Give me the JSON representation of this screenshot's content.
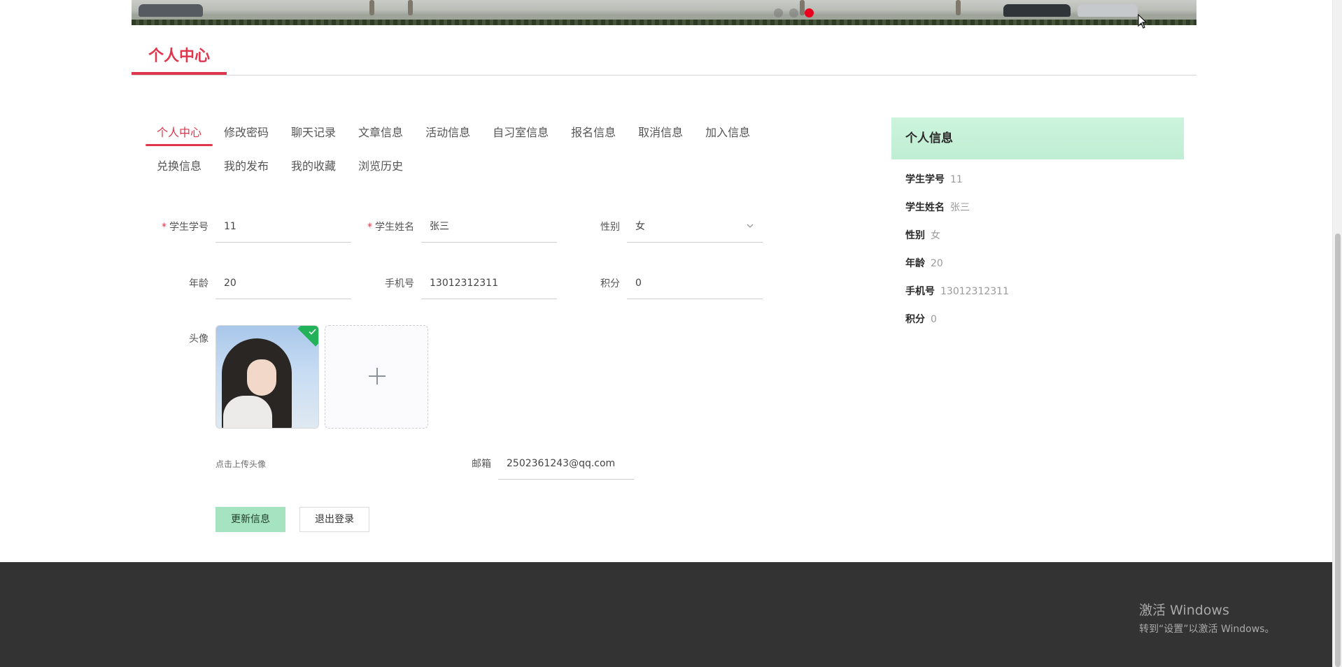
{
  "banner": {
    "carousel_active_index": 2,
    "carousel_count": 3
  },
  "page_title": "个人中心",
  "tabs": [
    {
      "label": "个人中心",
      "active": true
    },
    {
      "label": "修改密码"
    },
    {
      "label": "聊天记录"
    },
    {
      "label": "文章信息"
    },
    {
      "label": "活动信息"
    },
    {
      "label": "自习室信息"
    },
    {
      "label": "报名信息"
    },
    {
      "label": "取消信息"
    },
    {
      "label": "加入信息"
    },
    {
      "label": "兑换信息"
    },
    {
      "label": "我的发布"
    },
    {
      "label": "我的收藏"
    },
    {
      "label": "浏览历史"
    }
  ],
  "form": {
    "student_id": {
      "label": "学生学号",
      "value": "11",
      "required": true
    },
    "student_name": {
      "label": "学生姓名",
      "value": "张三",
      "required": true
    },
    "gender": {
      "label": "性别",
      "value": "女"
    },
    "age": {
      "label": "年龄",
      "value": "20"
    },
    "phone": {
      "label": "手机号",
      "value": "13012312311"
    },
    "points": {
      "label": "积分",
      "value": "0"
    },
    "avatar": {
      "label": "头像",
      "hint": "点击上传头像"
    },
    "email": {
      "label": "邮箱",
      "value": "2502361243@qq.com"
    },
    "update_button": "更新信息",
    "logout_button": "退出登录"
  },
  "info_panel": {
    "title": "个人信息",
    "rows": [
      {
        "key": "学生学号",
        "value": "11"
      },
      {
        "key": "学生姓名",
        "value": "张三"
      },
      {
        "key": "性别",
        "value": "女"
      },
      {
        "key": "年龄",
        "value": "20"
      },
      {
        "key": "手机号",
        "value": "13012312311"
      },
      {
        "key": "积分",
        "value": "0"
      }
    ]
  },
  "watermark": {
    "line1": "激活 Windows",
    "line2": "转到“设置”以激活 Windows。"
  },
  "colors": {
    "accent": "#e0364d",
    "panel_green": "#cdf4dd",
    "update_button": "#a6e3c0",
    "footer": "#333333"
  },
  "icons": {
    "chevron": "chevron-down-icon",
    "plus": "plus-icon",
    "check": "check-icon"
  }
}
